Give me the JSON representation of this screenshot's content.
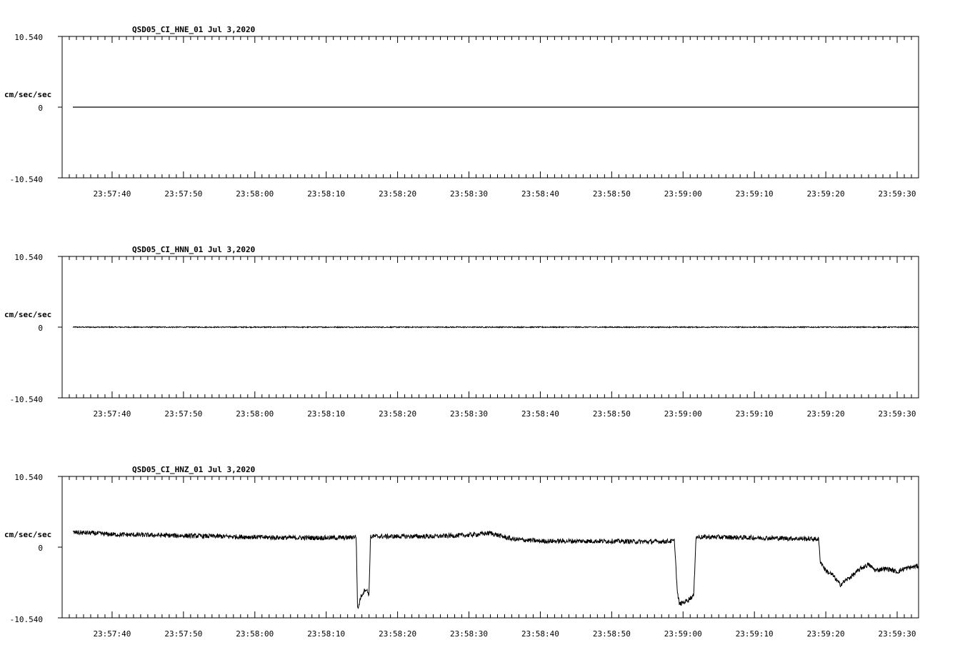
{
  "chart_data": [
    {
      "type": "line",
      "title": "QSD05_CI_HNE_01  Jul 3,2020",
      "ylabel": "cm/sec/sec",
      "ylim": [
        -10.54,
        10.54
      ],
      "y_ticks": [
        "10.540",
        "0",
        "-10.540"
      ],
      "xlim": [
        "23:57:33",
        "23:59:33"
      ],
      "x_ticks": [
        "23:57:40",
        "23:57:50",
        "23:58:00",
        "23:58:10",
        "23:58:20",
        "23:58:30",
        "23:58:40",
        "23:58:50",
        "23:59:00",
        "23:59:10",
        "23:59:20",
        "23:59:30"
      ],
      "series": [
        {
          "x": [
            "23:57:34.5",
            "23:59:33"
          ],
          "values": [
            0,
            0
          ]
        }
      ]
    },
    {
      "type": "line",
      "title": "QSD05_CI_HNN_01  Jul 3,2020",
      "ylabel": "cm/sec/sec",
      "ylim": [
        -10.54,
        10.54
      ],
      "y_ticks": [
        "10.540",
        "0",
        "-10.540"
      ],
      "xlim": [
        "23:57:33",
        "23:59:33"
      ],
      "x_ticks": [
        "23:57:40",
        "23:57:50",
        "23:58:00",
        "23:58:10",
        "23:58:20",
        "23:58:30",
        "23:58:40",
        "23:58:50",
        "23:59:00",
        "23:59:10",
        "23:59:20",
        "23:59:30"
      ],
      "series": [
        {
          "x": [
            "23:57:34.5",
            "23:59:33"
          ],
          "values": [
            0,
            0
          ],
          "noise": 0.08
        }
      ]
    },
    {
      "type": "line",
      "title": "QSD05_CI_HNZ_01  Jul 3,2020",
      "ylabel": "cm/sec/sec",
      "ylim": [
        -10.54,
        10.54
      ],
      "y_ticks": [
        "10.540",
        "0",
        "-10.540"
      ],
      "xlim": [
        "23:57:33",
        "23:59:33"
      ],
      "x_ticks": [
        "23:57:40",
        "23:57:50",
        "23:58:00",
        "23:58:10",
        "23:58:20",
        "23:58:30",
        "23:58:40",
        "23:58:50",
        "23:59:00",
        "23:59:10",
        "23:59:20",
        "23:59:30"
      ],
      "series": [
        {
          "x": [
            "23:57:34.5",
            "23:57:37",
            "23:57:40",
            "23:57:45",
            "23:57:50",
            "23:57:55",
            "23:58:00",
            "23:58:05",
            "23:58:10",
            "23:58:13",
            "23:58:14.2",
            "23:58:14.4",
            "23:58:14.8",
            "23:58:15.5",
            "23:58:16",
            "23:58:16.2",
            "23:58:16.5",
            "23:58:20",
            "23:58:25",
            "23:58:30",
            "23:58:33",
            "23:58:36",
            "23:58:40",
            "23:58:45",
            "23:58:50",
            "23:58:55",
            "23:58:58.8",
            "23:58:59.2",
            "23:58:59.5",
            "23:59:00.5",
            "23:59:01.5",
            "23:59:01.8",
            "23:59:02",
            "23:59:05",
            "23:59:10",
            "23:59:15",
            "23:59:19",
            "23:59:19.2",
            "23:59:20",
            "23:59:21",
            "23:59:22",
            "23:59:23",
            "23:59:24",
            "23:59:25",
            "23:59:26",
            "23:59:27",
            "23:59:28",
            "23:59:29",
            "23:59:30",
            "23:59:31",
            "23:59:33"
          ],
          "values": [
            2.2,
            2.1,
            1.9,
            1.8,
            1.7,
            1.6,
            1.5,
            1.4,
            1.4,
            1.4,
            1.6,
            -9.5,
            -7.5,
            -6.2,
            -7.0,
            1.5,
            1.6,
            1.6,
            1.6,
            1.8,
            2.1,
            1.2,
            0.9,
            0.9,
            0.9,
            0.8,
            0.9,
            -6.8,
            -8.5,
            -8.0,
            -7.2,
            1.5,
            1.5,
            1.5,
            1.4,
            1.3,
            1.2,
            -2.0,
            -3.5,
            -4.2,
            -5.6,
            -4.8,
            -4.0,
            -3.1,
            -2.6,
            -3.5,
            -3.2,
            -3.3,
            -3.7,
            -3.2,
            -2.8
          ],
          "noise": 0.35
        }
      ]
    }
  ]
}
